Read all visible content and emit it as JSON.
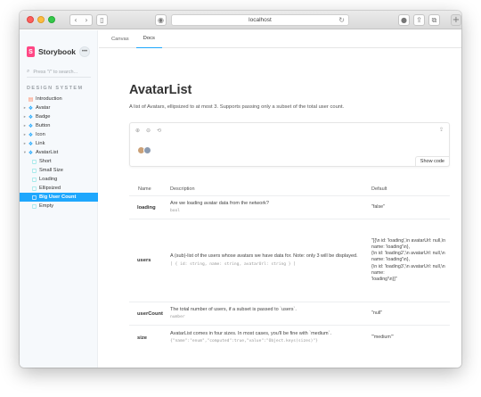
{
  "browser": {
    "url": "localhost",
    "nav_back": "‹",
    "nav_forward": "›"
  },
  "sidebar": {
    "brand": "Storybook",
    "brand_logo_letter": "S",
    "menu_label": "•••",
    "search_placeholder": "Press \"/\" to search...",
    "section_title": "DESIGN SYSTEM",
    "items": [
      {
        "label": "Introduction",
        "icon": "document-icon",
        "level": 0,
        "expandable": false
      },
      {
        "label": "Avatar",
        "icon": "component-icon",
        "level": 0,
        "expandable": true
      },
      {
        "label": "Badge",
        "icon": "component-icon",
        "level": 0,
        "expandable": true
      },
      {
        "label": "Button",
        "icon": "component-icon",
        "level": 0,
        "expandable": true
      },
      {
        "label": "Icon",
        "icon": "component-icon",
        "level": 0,
        "expandable": true
      },
      {
        "label": "Link",
        "icon": "component-icon",
        "level": 0,
        "expandable": true
      },
      {
        "label": "AvatarList",
        "icon": "component-icon",
        "level": 0,
        "expandable": true,
        "expanded": true
      },
      {
        "label": "Short",
        "icon": "story-icon",
        "level": 1
      },
      {
        "label": "Small Size",
        "icon": "story-icon",
        "level": 1
      },
      {
        "label": "Loading",
        "icon": "story-icon",
        "level": 1
      },
      {
        "label": "Ellipsized",
        "icon": "story-icon",
        "level": 1
      },
      {
        "label": "Big User Count",
        "icon": "story-icon",
        "level": 1,
        "selected": true
      },
      {
        "label": "Empty",
        "icon": "story-icon",
        "level": 1
      }
    ]
  },
  "tabs": [
    {
      "label": "Canvas",
      "active": false
    },
    {
      "label": "Docs",
      "active": true
    }
  ],
  "doc": {
    "title": "AvatarList",
    "description": "A list of Avatars, ellipsized to at most 3. Supports passing only a subset of the total user count.",
    "show_code": "Show code"
  },
  "props_table": {
    "headers": {
      "name": "Name",
      "description": "Description",
      "default": "Default"
    },
    "rows": [
      {
        "name": "loading",
        "description": "Are we loading avatar data from the network?",
        "type": "bool",
        "default": "\"false\""
      },
      {
        "name": "users",
        "description": "A (sub)-list of the users whose avatars we have data for. Note: only 3 will be displayed.",
        "type": "[ { id: string, name: string, avatarUrl: string } ]",
        "default": "\"[{\\n id: 'loading',\\n avatarUrl: null,\\n name: 'loading'\\n},\n{\\n id: 'loading2',\\n avatarUrl: null,\\n name: 'loading'\\n},\n{\\n id: 'loading3',\\n avatarUrl: null,\\n name:\n'loading'\\n}]\""
      },
      {
        "name": "userCount",
        "description": "The total number of users, if a subset is passed to `users`.",
        "type": "number",
        "default": "\"null\""
      },
      {
        "name": "size",
        "description": "AvatarList comes in four sizes. In most cases, you'll be fine with `medium`.",
        "type": "{\"name\":\"enum\",\"computed\":true,\"value\":\"Object.keys(sizes)\"}",
        "default": "\"'medium'\""
      }
    ]
  }
}
